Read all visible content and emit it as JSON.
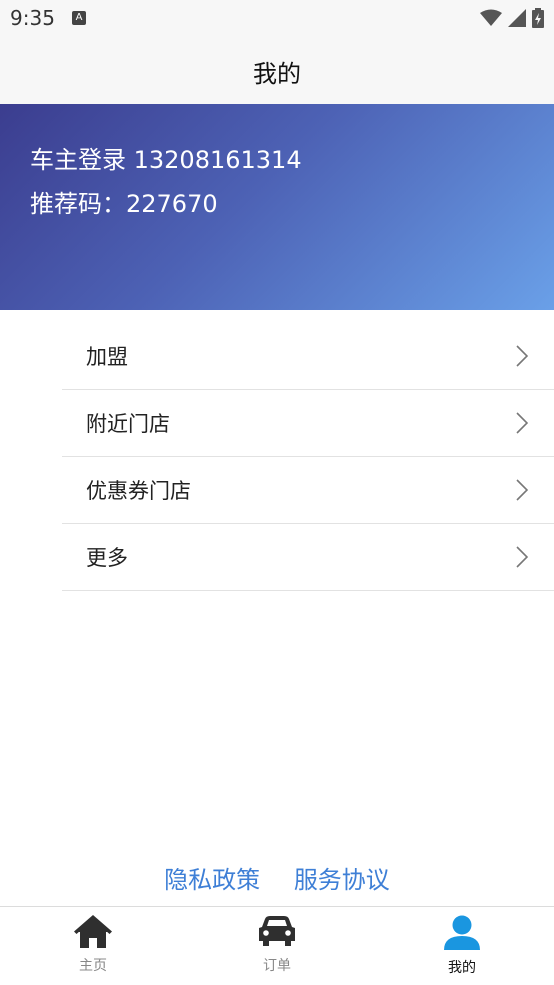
{
  "status_bar": {
    "time": "9:35",
    "notification_icon": "A"
  },
  "header": {
    "title": "我的"
  },
  "profile": {
    "login_text": "车主登录 13208161314",
    "referral_text": "推荐码：227670"
  },
  "menu": {
    "items": [
      {
        "label": "加盟"
      },
      {
        "label": "附近门店"
      },
      {
        "label": "优惠券门店"
      },
      {
        "label": "更多"
      }
    ]
  },
  "footer": {
    "privacy": "隐私政策",
    "service": "服务协议"
  },
  "tabs": [
    {
      "label": "主页",
      "icon": "home-icon"
    },
    {
      "label": "订单",
      "icon": "car-icon"
    },
    {
      "label": "我的",
      "icon": "user-icon"
    }
  ],
  "colors": {
    "accent": "#1a96e0",
    "link": "#3e7fd6",
    "hero_start": "#3b3d8f",
    "hero_end": "#6aa0e8"
  }
}
